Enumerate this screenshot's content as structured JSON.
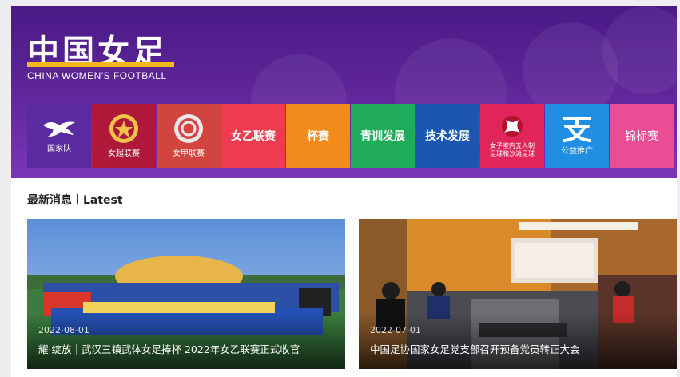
{
  "header": {
    "logo_cn": "中国女足",
    "logo_en": "CHINA WOMEN'S FOOTBALL"
  },
  "tiles": [
    {
      "label": "国家队",
      "icon": "phoenix-icon",
      "color": "#5a2ba0"
    },
    {
      "label": "女超联赛",
      "icon": "super-league-badge-icon",
      "color": "#b0183a"
    },
    {
      "label": "女甲联赛",
      "icon": "league-a-badge-icon",
      "color": "#d2453e"
    },
    {
      "label": "女乙联赛",
      "icon": "",
      "color": "#ee3b4f"
    },
    {
      "label": "杯赛",
      "icon": "",
      "color": "#f28a1c"
    },
    {
      "label": "青训发展",
      "icon": "",
      "color": "#1fab5a"
    },
    {
      "label": "技术发展",
      "icon": "",
      "color": "#1b57b0"
    },
    {
      "label_line1": "女子室内五人制",
      "label_line2": "足球和沙滩足球",
      "icon": "futsal-ball-icon",
      "color": "#e0255b"
    },
    {
      "label": "公益推广",
      "icon": "charity-character-icon",
      "color": "#1f8ee3"
    },
    {
      "label": "锦标赛",
      "icon": "",
      "color": "#ea4d93"
    }
  ],
  "latest": {
    "heading": "最新消息丨Latest",
    "items": [
      {
        "date": "2022-08-01",
        "title": "耀·绽放｜武汉三镇武体女足捧杯 2022年女乙联赛正式收官"
      },
      {
        "date": "2022-07-01",
        "title": "中国足协国家女足党支部召开预备党员转正大会"
      }
    ]
  }
}
